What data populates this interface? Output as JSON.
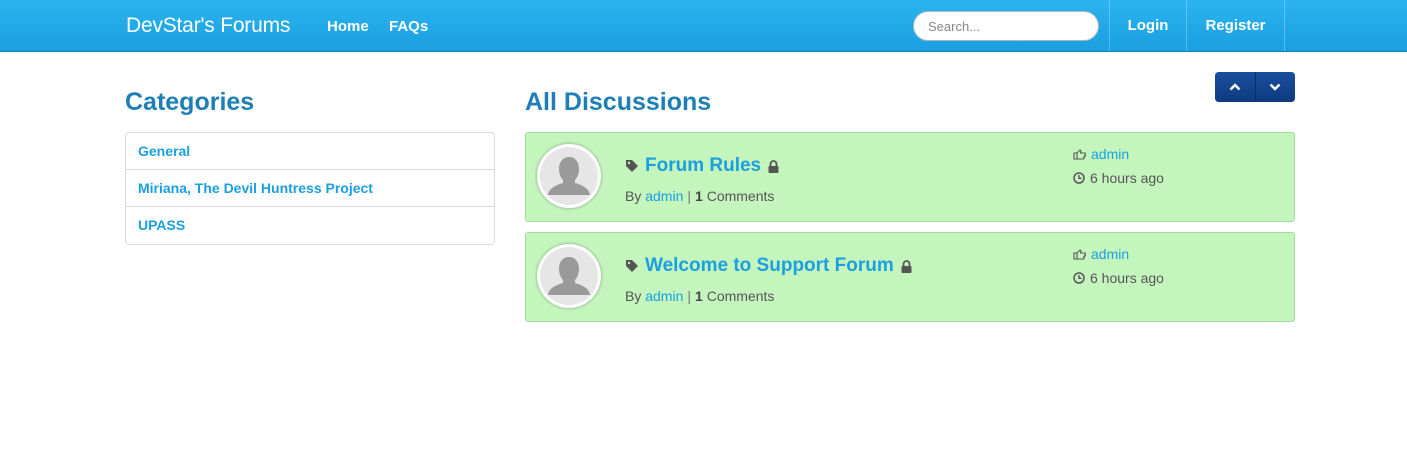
{
  "navbar": {
    "brand": "DevStar's Forums",
    "links": [
      "Home",
      "FAQs"
    ],
    "search_placeholder": "Search...",
    "login": "Login",
    "register": "Register"
  },
  "sidebar": {
    "title": "Categories",
    "items": [
      {
        "label": "General"
      },
      {
        "label": "Miriana, The Devil Huntress Project"
      },
      {
        "label": "UPASS"
      }
    ]
  },
  "main": {
    "title": "All Discussions",
    "discussions": [
      {
        "title": "Forum Rules",
        "by_label": "By",
        "author": "admin",
        "comment_count": "1",
        "comments_label": "Comments",
        "last_user": "admin",
        "time": "6 hours ago"
      },
      {
        "title": "Welcome to Support Forum",
        "by_label": "By",
        "author": "admin",
        "comment_count": "1",
        "comments_label": "Comments",
        "last_user": "admin",
        "time": "6 hours ago"
      }
    ]
  },
  "colors": {
    "navbar": "#1fa8e8",
    "heading": "#1e7fb8",
    "link": "#1a9fe0",
    "discussion_bg": "#c4f5bd",
    "sort_button": "#0d3a80"
  },
  "icons": {
    "sort_up": "chevron-up-icon",
    "sort_down": "chevron-down-icon",
    "tag": "tag-icon",
    "lock": "lock-icon",
    "hand": "hand-pointing-icon",
    "clock": "clock-icon",
    "avatar": "default-user-avatar"
  }
}
